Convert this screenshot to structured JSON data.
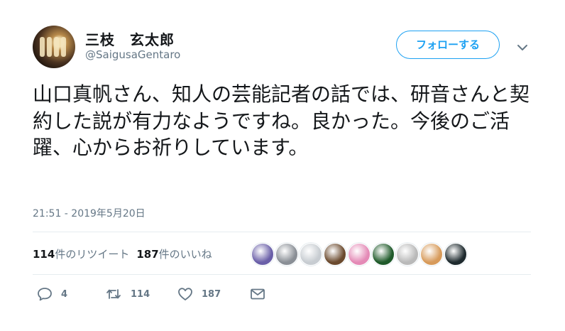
{
  "user": {
    "display_name": "三枝　玄太郎",
    "handle": "@SaigusaGentaro"
  },
  "header": {
    "follow_label": "フォローする"
  },
  "tweet": {
    "text": "山口真帆さん、知人の芸能記者の話では、研音さんと契約した説が有力なようですね。良かった。今後のご活躍、心からお祈りしています。",
    "timestamp": "21:51 - 2019年5月20日"
  },
  "stats": {
    "retweets_count": "114",
    "retweets_label": "件のリツイート",
    "likes_count": "187",
    "likes_label": "件のいいね"
  },
  "likers": [
    {
      "icon": "liker-avatar-1",
      "color": "#6a5fa8"
    },
    {
      "icon": "liker-avatar-2",
      "color": "#8a8f96"
    },
    {
      "icon": "liker-avatar-3",
      "color": "#c7ccd1"
    },
    {
      "icon": "liker-avatar-4",
      "color": "#6b4a2e"
    },
    {
      "icon": "liker-avatar-5",
      "color": "#e48ab6"
    },
    {
      "icon": "liker-avatar-6",
      "color": "#1f5a2a"
    },
    {
      "icon": "liker-avatar-7",
      "color": "#b9b9b9"
    },
    {
      "icon": "liker-avatar-8",
      "color": "#d79a5a"
    },
    {
      "icon": "liker-avatar-9",
      "color": "#1e2a2e"
    }
  ],
  "actions": {
    "reply_count": "4",
    "retweet_count": "114",
    "like_count": "187"
  },
  "colors": {
    "accent": "#1da1f2",
    "muted": "#657786",
    "text": "#14171a",
    "divider": "#e6ecf0"
  }
}
